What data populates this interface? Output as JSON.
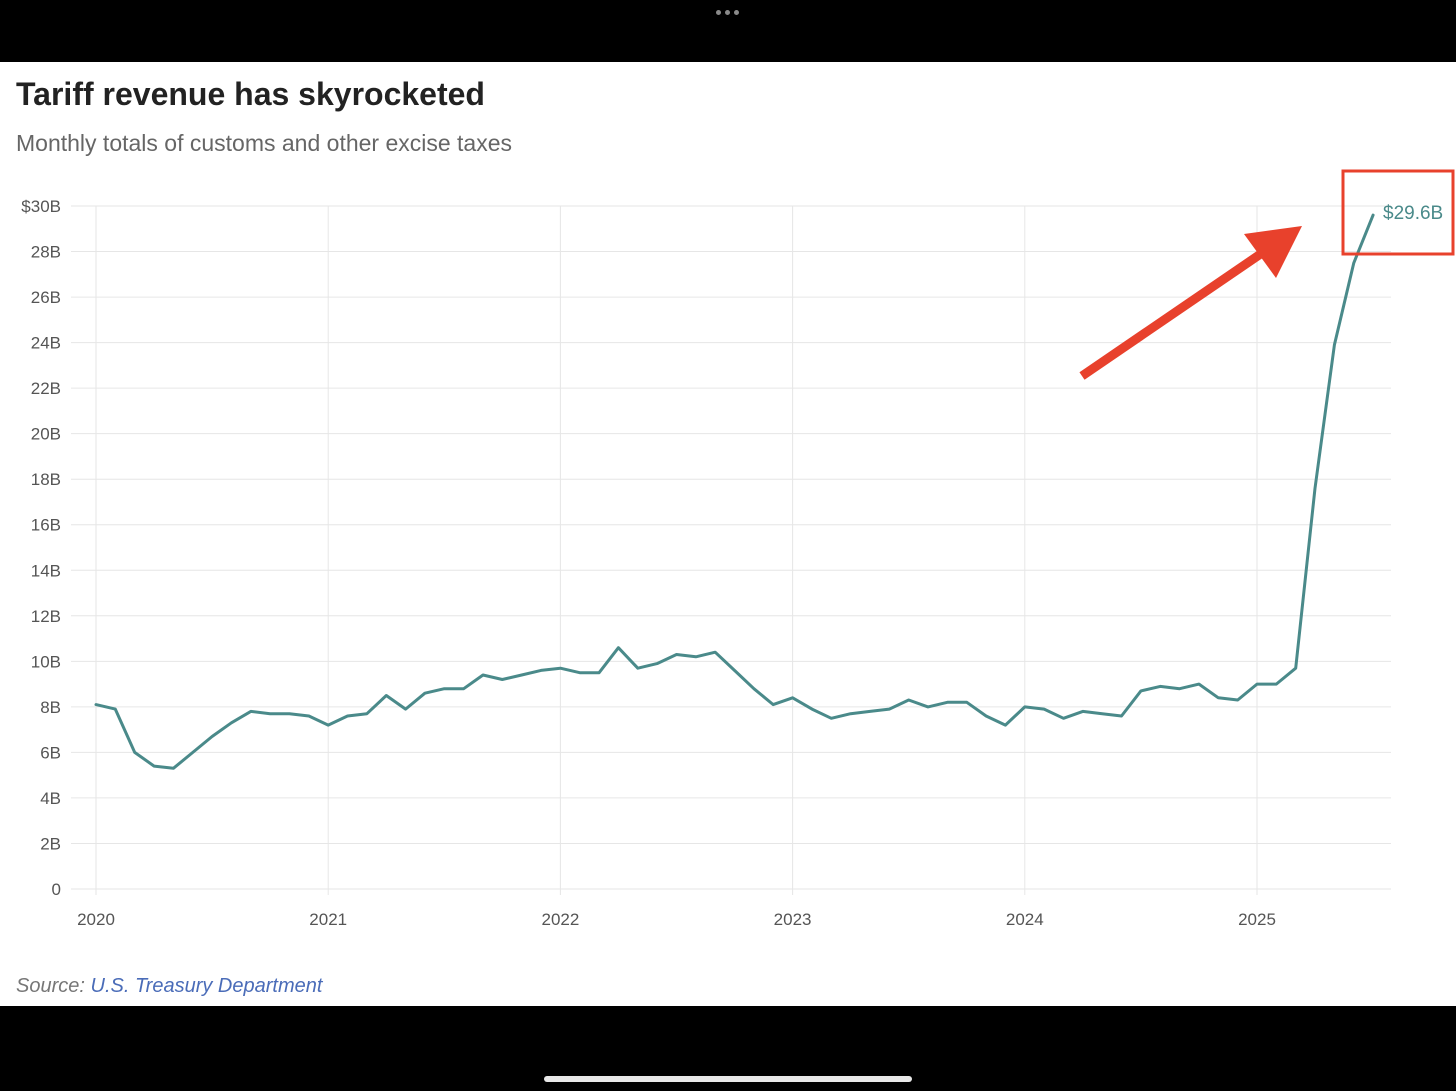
{
  "header": {
    "title": "Tariff revenue has skyrocketed",
    "subtitle": "Monthly totals of customs and other excise taxes"
  },
  "footer": {
    "source_label": "Source:",
    "source_link": "U.S. Treasury Department"
  },
  "annotation": {
    "callout": "$29.6B",
    "arrow_color": "#e8412c",
    "box_color": "#e8412c"
  },
  "colors": {
    "line": "#4a8a8a",
    "grid": "#e6e6e6",
    "tick_text": "#555555"
  },
  "chart_data": {
    "type": "line",
    "title": "Tariff revenue has skyrocketed",
    "subtitle": "Monthly totals of customs and other excise taxes",
    "unit": "billions USD",
    "ylim": [
      0,
      30
    ],
    "y_ticks": [
      {
        "v": 0,
        "label": "0"
      },
      {
        "v": 2,
        "label": "2B"
      },
      {
        "v": 4,
        "label": "4B"
      },
      {
        "v": 6,
        "label": "6B"
      },
      {
        "v": 8,
        "label": "8B"
      },
      {
        "v": 10,
        "label": "10B"
      },
      {
        "v": 12,
        "label": "12B"
      },
      {
        "v": 14,
        "label": "14B"
      },
      {
        "v": 16,
        "label": "16B"
      },
      {
        "v": 18,
        "label": "18B"
      },
      {
        "v": 20,
        "label": "20B"
      },
      {
        "v": 22,
        "label": "22B"
      },
      {
        "v": 24,
        "label": "24B"
      },
      {
        "v": 26,
        "label": "26B"
      },
      {
        "v": 28,
        "label": "28B"
      },
      {
        "v": 30,
        "label": "$30B"
      }
    ],
    "x_ticks": [
      "2020",
      "2021",
      "2022",
      "2023",
      "2024",
      "2025"
    ],
    "grid": true,
    "series": [
      {
        "x": [
          "2020-01",
          "2020-02",
          "2020-03",
          "2020-04",
          "2020-05",
          "2020-06",
          "2020-07",
          "2020-08",
          "2020-09",
          "2020-10",
          "2020-11",
          "2020-12",
          "2021-01",
          "2021-02",
          "2021-03",
          "2021-04",
          "2021-05",
          "2021-06",
          "2021-07",
          "2021-08",
          "2021-09",
          "2021-10",
          "2021-11",
          "2021-12",
          "2022-01",
          "2022-02",
          "2022-03",
          "2022-04",
          "2022-05",
          "2022-06",
          "2022-07",
          "2022-08",
          "2022-09",
          "2022-10",
          "2022-11",
          "2022-12",
          "2023-01",
          "2023-02",
          "2023-03",
          "2023-04",
          "2023-05",
          "2023-06",
          "2023-07",
          "2023-08",
          "2023-09",
          "2023-10",
          "2023-11",
          "2023-12",
          "2024-01",
          "2024-02",
          "2024-03",
          "2024-04",
          "2024-05",
          "2024-06",
          "2024-07",
          "2024-08",
          "2024-09",
          "2024-10",
          "2024-11",
          "2024-12",
          "2025-01",
          "2025-02",
          "2025-03",
          "2025-04",
          "2025-05",
          "2025-06",
          "2025-07"
        ],
        "values": [
          8.1,
          7.9,
          6.0,
          5.4,
          5.3,
          6.0,
          6.7,
          7.3,
          7.8,
          7.7,
          7.7,
          7.6,
          7.2,
          7.6,
          7.7,
          8.5,
          7.9,
          8.6,
          8.8,
          8.8,
          9.4,
          9.2,
          9.4,
          9.6,
          9.7,
          9.5,
          9.5,
          10.6,
          9.7,
          9.9,
          10.3,
          10.2,
          10.4,
          9.6,
          8.8,
          8.1,
          8.4,
          7.9,
          7.5,
          7.7,
          7.8,
          7.9,
          8.3,
          8.0,
          8.2,
          8.2,
          7.6,
          7.2,
          8.0,
          7.9,
          7.5,
          7.8,
          7.7,
          7.6,
          8.7,
          8.9,
          8.8,
          9.0,
          8.4,
          8.3,
          9.0,
          9.0,
          9.7,
          17.6,
          23.9,
          27.5,
          29.6
        ]
      }
    ]
  }
}
